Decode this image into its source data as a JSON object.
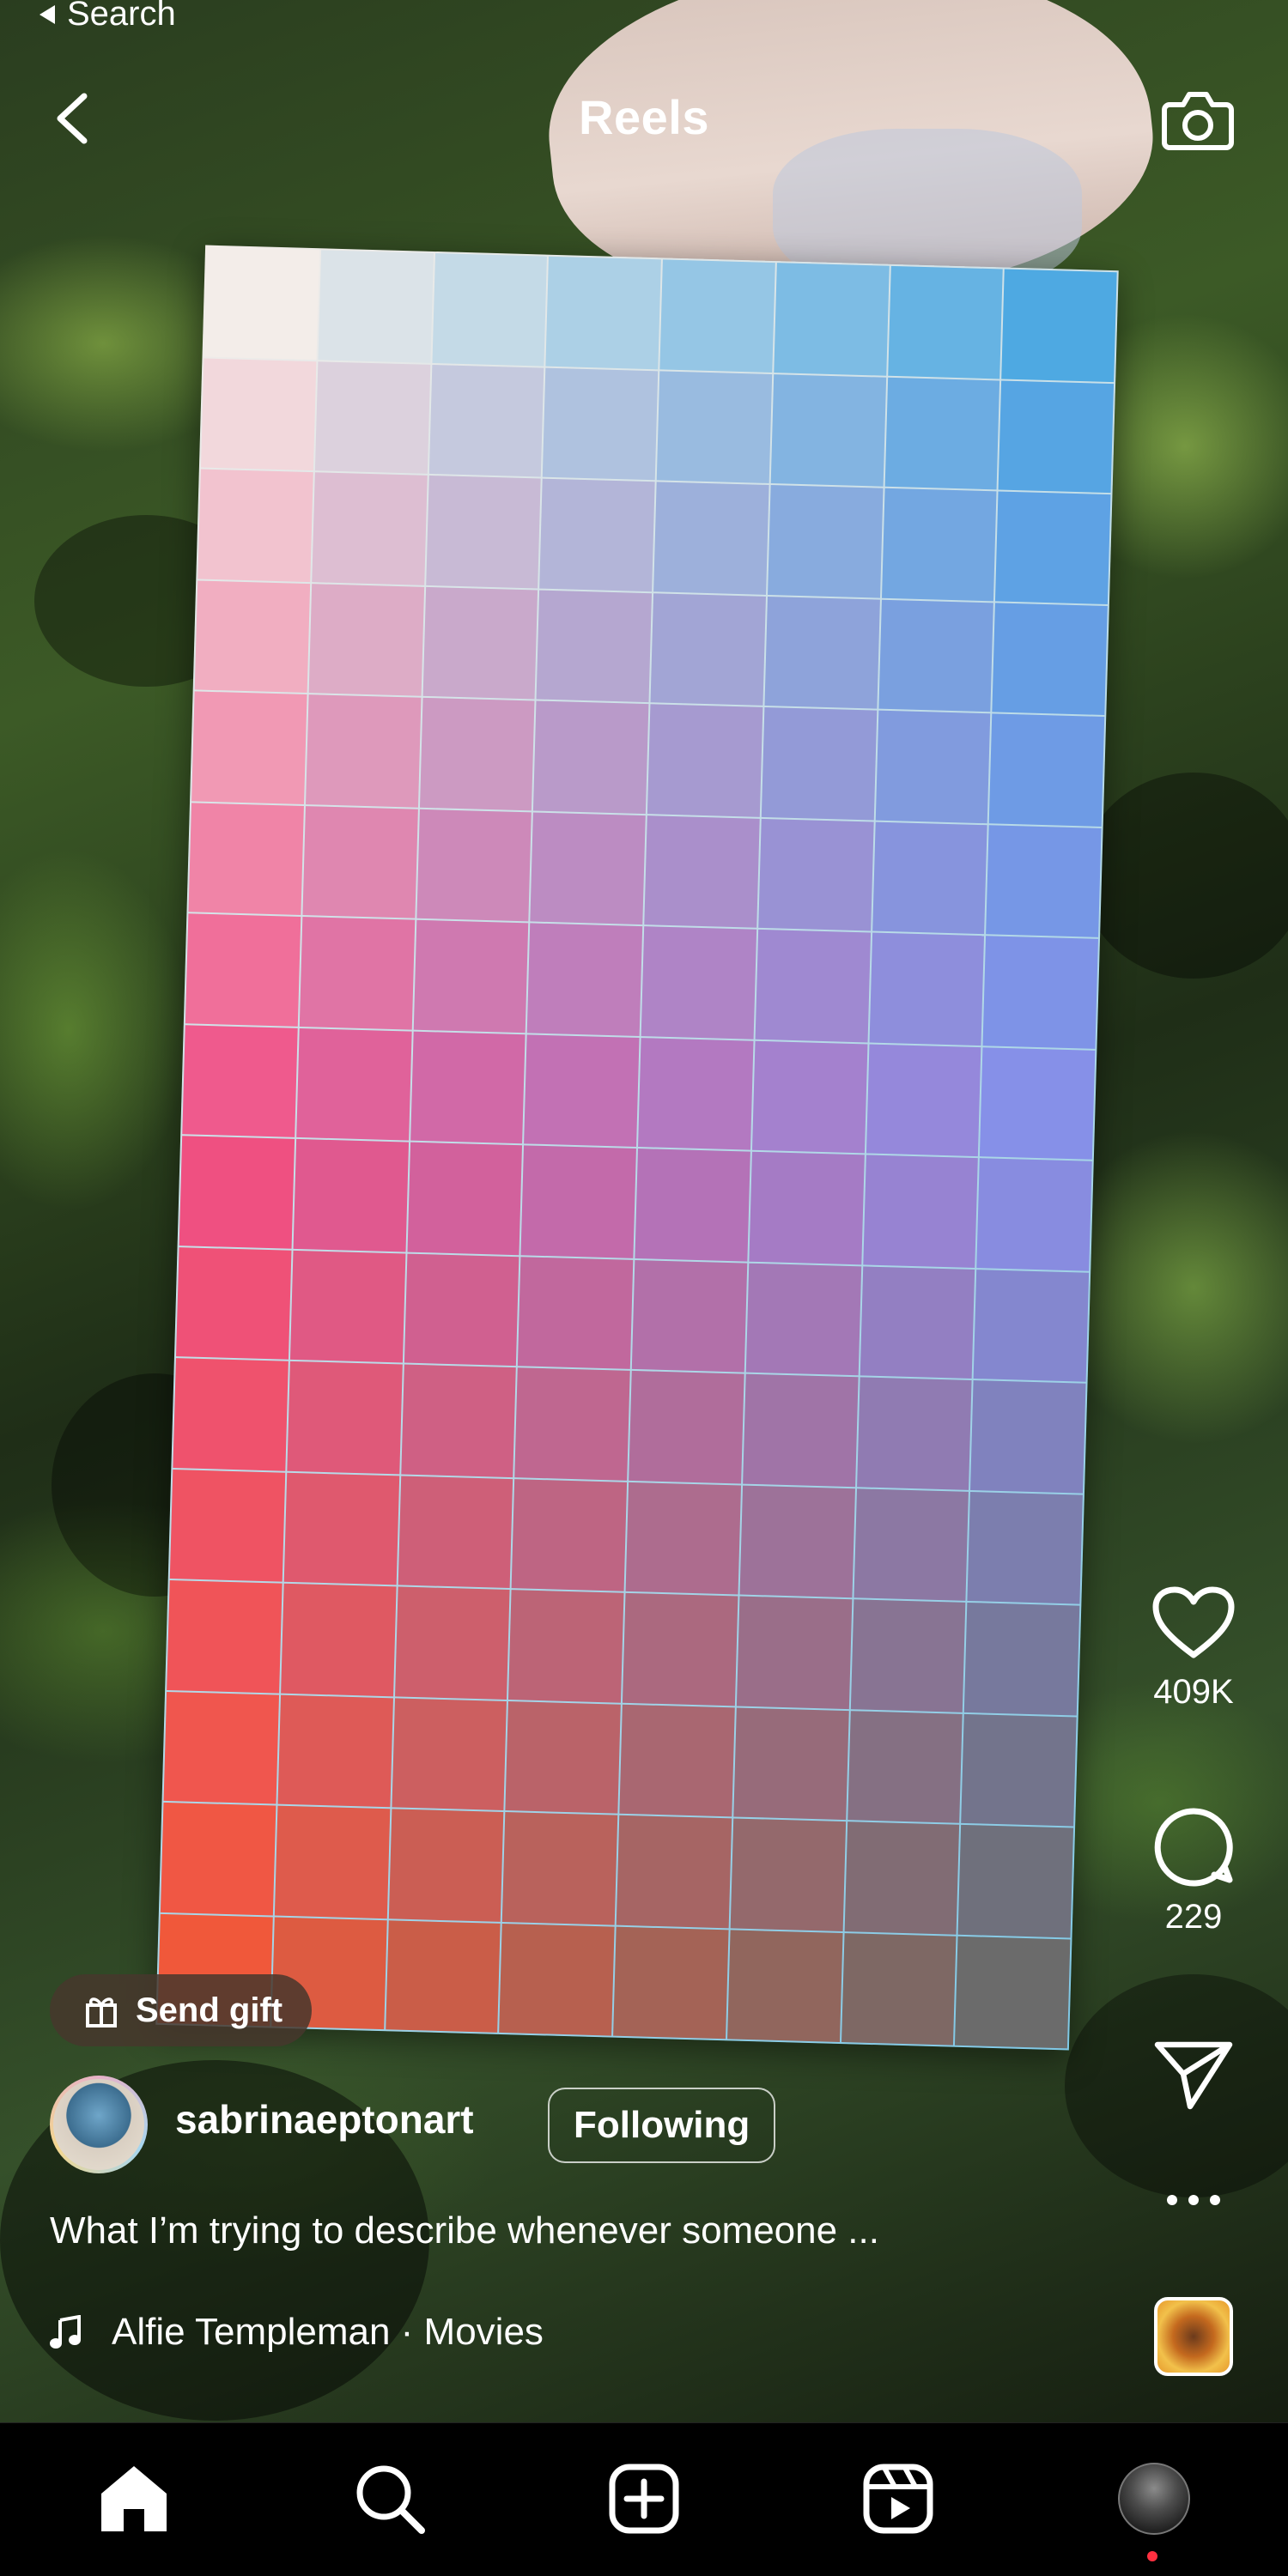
{
  "status_bar": {
    "back_to_app_label": "Search"
  },
  "header": {
    "title": "Reels"
  },
  "icons": {
    "back": "chevron-left-icon",
    "camera": "camera-icon",
    "like": "heart-icon",
    "comment": "comment-icon",
    "share": "send-icon",
    "more": "more-horizontal-icon",
    "music": "music-note-icon",
    "gift": "gift-icon"
  },
  "actions": {
    "likes_count": "409K",
    "comments_count": "229"
  },
  "reel": {
    "send_gift_label": "Send gift",
    "username": "sabrinaeptonart",
    "follow_state_label": "Following",
    "caption": "What I’m trying to describe whenever someone ...",
    "audio": "Alfie Templeman · Movies"
  },
  "bottom_nav": {
    "items": [
      "home-icon",
      "search-icon",
      "create-icon",
      "reels-icon",
      "profile-avatar"
    ],
    "active": "home-icon",
    "notification_dot_color": "#ff3040"
  },
  "colors": {
    "background": "#000000",
    "text": "#ffffff",
    "card_top_left": "#f3ede9",
    "card_top_right": "#4ea9e2",
    "card_bottom_left": "#f0583a",
    "card_bottom_right": "#6b6b6b",
    "card_mid_left": "#ef4f86",
    "card_mid_right": "#8a8ee8"
  }
}
